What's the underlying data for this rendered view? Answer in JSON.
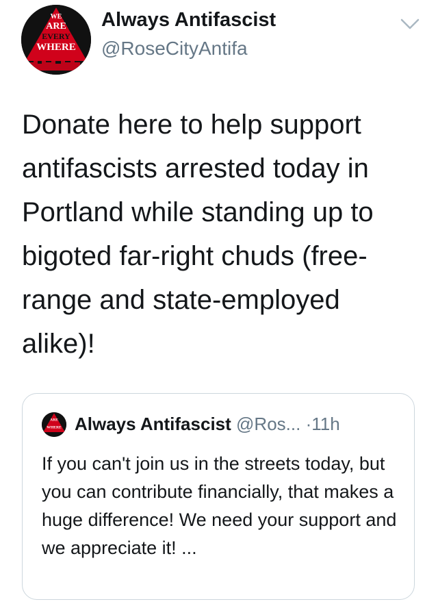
{
  "author": {
    "name": "Always Antifascist",
    "handle": "@RoseCityAntifa",
    "avatar_text": [
      "WE",
      "ARE",
      "EVERY",
      "WHERE"
    ]
  },
  "tweet": {
    "text": "Donate here to help support antifascists arrested today in Portland while standing up to bigoted far-right chuds (free-range and state-employed alike)!"
  },
  "quoted_tweet": {
    "name": "Always Antifascist",
    "handle": "@Ros...",
    "separator": "·",
    "time": "11h",
    "text": "If you can't join us in the streets today, but you can contribute financially, that makes a huge difference! We need your support and we appreciate it!  ..."
  },
  "icons": {
    "menu": "chevron-down-icon"
  },
  "colors": {
    "primary_text": "#14171a",
    "secondary_text": "#657786",
    "border": "#ccd6dd",
    "avatar_red": "#d0021b"
  }
}
